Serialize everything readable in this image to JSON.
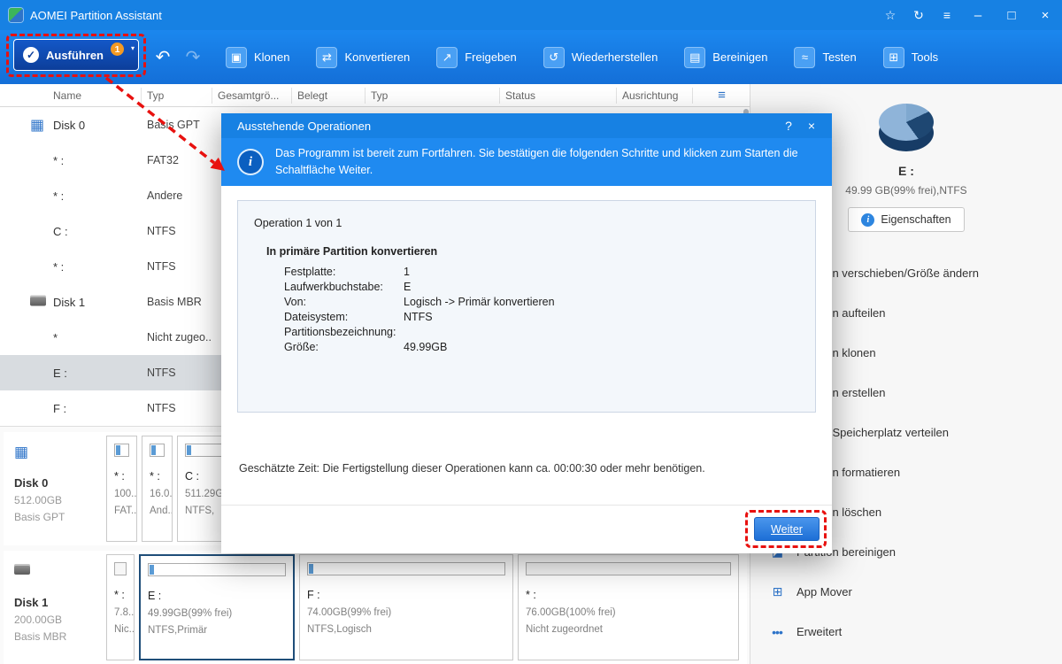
{
  "colors": {
    "accent": "#1781e3",
    "annotation_red": "#e8110f",
    "badge_orange": "#f59a23",
    "selected_row": "#d8dce0"
  },
  "titlebar": {
    "app_title": "AOMEI Partition Assistant"
  },
  "toolbar": {
    "execute_label": "Ausführen",
    "execute_badge": "1",
    "buttons": [
      {
        "label": "Klonen",
        "glyph": "▣"
      },
      {
        "label": "Konvertieren",
        "glyph": "⇄"
      },
      {
        "label": "Freigeben",
        "glyph": "↗"
      },
      {
        "label": "Wiederherstellen",
        "glyph": "↺"
      },
      {
        "label": "Bereinigen",
        "glyph": "▤"
      },
      {
        "label": "Testen",
        "glyph": "≈"
      },
      {
        "label": "Tools",
        "glyph": "⊞"
      }
    ]
  },
  "table": {
    "headers": [
      "Name",
      "Typ",
      "Gesamtgrö...",
      "Belegt",
      "Typ",
      "Status",
      "Ausrichtung"
    ],
    "rows": [
      {
        "name": "Disk 0",
        "type": "Basis GPT"
      },
      {
        "name": "* :",
        "type": "FAT32"
      },
      {
        "name": "* :",
        "type": "Andere"
      },
      {
        "name": "C :",
        "type": "NTFS"
      },
      {
        "name": "* :",
        "type": "NTFS"
      },
      {
        "name": "Disk 1",
        "type": "Basis MBR"
      },
      {
        "name": "*",
        "type": "Nicht zugeo..."
      },
      {
        "name": "E :",
        "type": "NTFS"
      },
      {
        "name": "F :",
        "type": "NTFS"
      }
    ]
  },
  "disks": [
    {
      "name": "Disk 0",
      "capacity": "512.00GB",
      "style": "Basis GPT",
      "partitions": [
        {
          "label": "* :",
          "size": "100...",
          "fs": "FAT..."
        },
        {
          "label": "* :",
          "size": "16.0...",
          "fs": "And..."
        },
        {
          "label": "C :",
          "size": "511.29GB",
          "fs": "NTFS,"
        }
      ]
    },
    {
      "name": "Disk 1",
      "capacity": "200.00GB",
      "style": "Basis MBR",
      "partitions": [
        {
          "label": "* :",
          "size": "7.8...",
          "fs": "Nic..."
        },
        {
          "label": "E :",
          "size": "49.99GB(99% frei)",
          "fs": "NTFS,Primär"
        },
        {
          "label": "F :",
          "size": "74.00GB(99% frei)",
          "fs": "NTFS,Logisch"
        },
        {
          "label": "* :",
          "size": "76.00GB(100% frei)",
          "fs": "Nicht zugeordnet"
        }
      ]
    }
  ],
  "sidebar": {
    "volume_name": "E :",
    "volume_info": "49.99 GB(99% frei),NTFS",
    "properties_label": "Eigenschaften",
    "menu": [
      {
        "label": "Partition verschieben/Größe ändern",
        "glyph": "⇔"
      },
      {
        "label": "Partition aufteilen",
        "glyph": "◫"
      },
      {
        "label": "Partition klonen",
        "glyph": "▣"
      },
      {
        "label": "Partition erstellen",
        "glyph": "+"
      },
      {
        "label": "Freien Speicherplatz verteilen",
        "glyph": "⇄"
      },
      {
        "label": "Partition formatieren",
        "glyph": "▤"
      },
      {
        "label": "Partition löschen",
        "glyph": "×"
      },
      {
        "label": "Partition bereinigen",
        "glyph": "◪"
      },
      {
        "label": "App Mover",
        "glyph": "⊞"
      },
      {
        "label": "Erweitert",
        "glyph": "•••"
      }
    ]
  },
  "dialog": {
    "title": "Ausstehende Operationen",
    "help_icon": "?",
    "close_icon": "×",
    "info_text": "Das Programm ist bereit zum Fortfahren. Sie bestätigen die folgenden Schritte und klicken zum Starten die Schaltfläche Weiter.",
    "operation_count": "Operation 1 von 1",
    "operation_title": "In primäre Partition konvertieren",
    "fields": [
      {
        "label": "Festplatte:",
        "value": "1"
      },
      {
        "label": "Laufwerkbuchstabe:",
        "value": "E"
      },
      {
        "label": "Von:",
        "value": "Logisch -> Primär konvertieren"
      },
      {
        "label": "Dateisystem:",
        "value": "NTFS"
      },
      {
        "label": "Partitionsbezeichnung:",
        "value": ""
      },
      {
        "label": "Größe:",
        "value": "49.99GB"
      }
    ],
    "estimate_text": "Geschätzte Zeit: Die Fertigstellung dieser Operationen kann ca. 00:00:30 oder mehr benötigen.",
    "next_label": "Weiter"
  }
}
